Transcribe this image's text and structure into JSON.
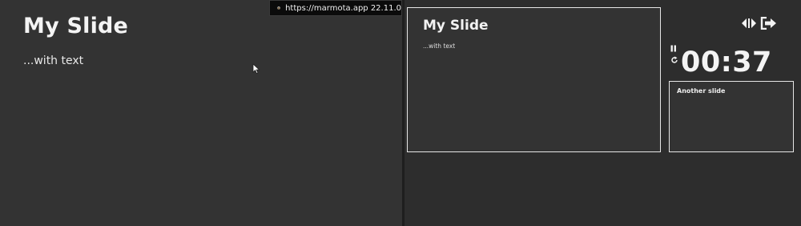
{
  "current_slide": {
    "title": "My Slide",
    "text": "...with text"
  },
  "tooltip": {
    "text": "https://marmota.app 22.11.0",
    "icon": "marmot-logo-icon"
  },
  "presenter": {
    "preview_current": {
      "title": "My Slide",
      "text": "...with text"
    },
    "preview_next": {
      "title": "Another slide"
    },
    "timer": "00:37",
    "icons": [
      "pause-icon",
      "reset-icon",
      "switch-screens-icon",
      "exit-icon"
    ]
  },
  "colors": {
    "slide_background": "#333333",
    "presenter_background": "#2d2d2d",
    "text": "#f2f2f2",
    "preview_border": "#e6e6e6",
    "tooltip_background": "#0b0b0b"
  }
}
